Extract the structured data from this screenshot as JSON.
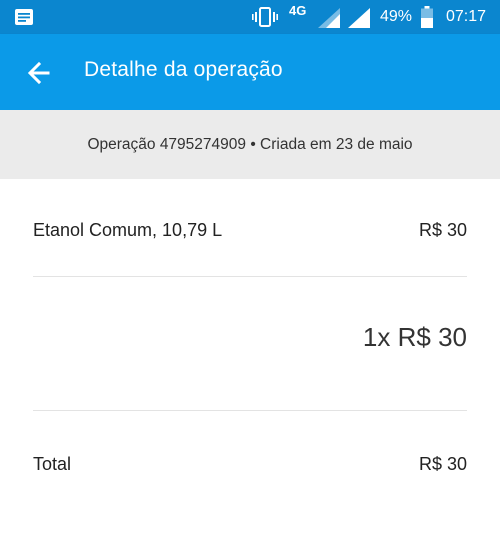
{
  "status_bar": {
    "network": "4G",
    "battery": "49%",
    "time": "07:17",
    "icons": [
      "notification-icon",
      "vibrate-icon",
      "signal-icon",
      "battery-icon"
    ]
  },
  "app_bar": {
    "title": "Detalhe da operação",
    "back_icon": "arrow-back-icon"
  },
  "operation": {
    "summary": "Operação 4795274909 • Criada em 23 de maio"
  },
  "item": {
    "name": "Etanol Comum, 10,79 L",
    "price": "R$ 30"
  },
  "quantity_line": "1x R$ 30",
  "total": {
    "label": "Total",
    "value": "R$ 30"
  },
  "colors": {
    "status_bar": "#0b86cf",
    "app_bar": "#0b9ae8",
    "banner": "#ebebeb"
  }
}
